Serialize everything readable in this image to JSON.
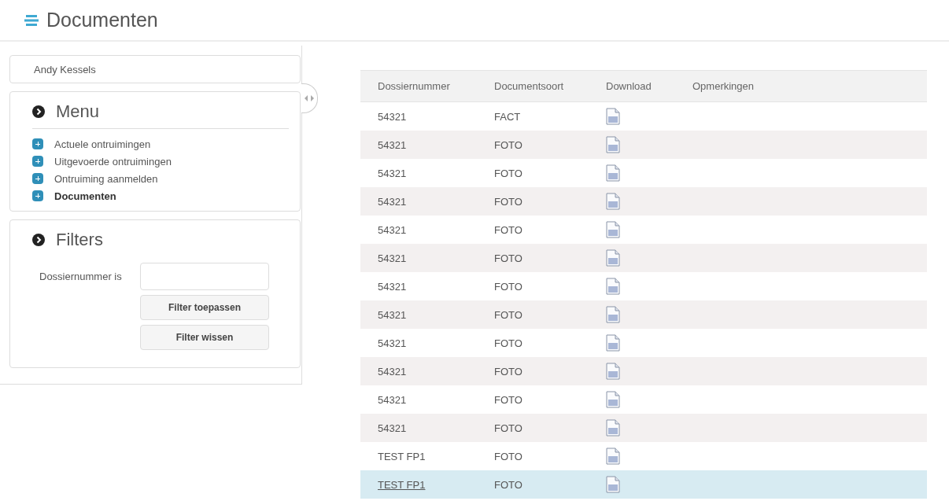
{
  "page": {
    "title": "Documenten"
  },
  "user": {
    "name": "Andy Kessels"
  },
  "menu": {
    "title": "Menu",
    "items": [
      {
        "label": "Actuele ontruimingen",
        "selected": false
      },
      {
        "label": "Uitgevoerde ontruimingen",
        "selected": false
      },
      {
        "label": "Ontruiming aanmelden",
        "selected": false
      },
      {
        "label": "Documenten",
        "selected": true
      }
    ]
  },
  "filters": {
    "title": "Filters",
    "field_label": "Dossiernummer is",
    "buttons": [
      "Filter toepassen",
      "Filter wissen"
    ]
  },
  "table": {
    "columns": [
      "Dossiernummer",
      "Documentsoort",
      "Download",
      "Opmerkingen"
    ],
    "rows": [
      {
        "dossier": "54321",
        "type": "FACT",
        "selected": false
      },
      {
        "dossier": "54321",
        "type": "FOTO",
        "selected": false
      },
      {
        "dossier": "54321",
        "type": "FOTO",
        "selected": false
      },
      {
        "dossier": "54321",
        "type": "FOTO",
        "selected": false
      },
      {
        "dossier": "54321",
        "type": "FOTO",
        "selected": false
      },
      {
        "dossier": "54321",
        "type": "FOTO",
        "selected": false
      },
      {
        "dossier": "54321",
        "type": "FOTO",
        "selected": false
      },
      {
        "dossier": "54321",
        "type": "FOTO",
        "selected": false
      },
      {
        "dossier": "54321",
        "type": "FOTO",
        "selected": false
      },
      {
        "dossier": "54321",
        "type": "FOTO",
        "selected": false
      },
      {
        "dossier": "54321",
        "type": "FOTO",
        "selected": false
      },
      {
        "dossier": "54321",
        "type": "FOTO",
        "selected": false
      },
      {
        "dossier": "TEST FP1",
        "type": "FOTO",
        "selected": false
      },
      {
        "dossier": "TEST FP1",
        "type": "FOTO",
        "selected": true
      }
    ]
  }
}
